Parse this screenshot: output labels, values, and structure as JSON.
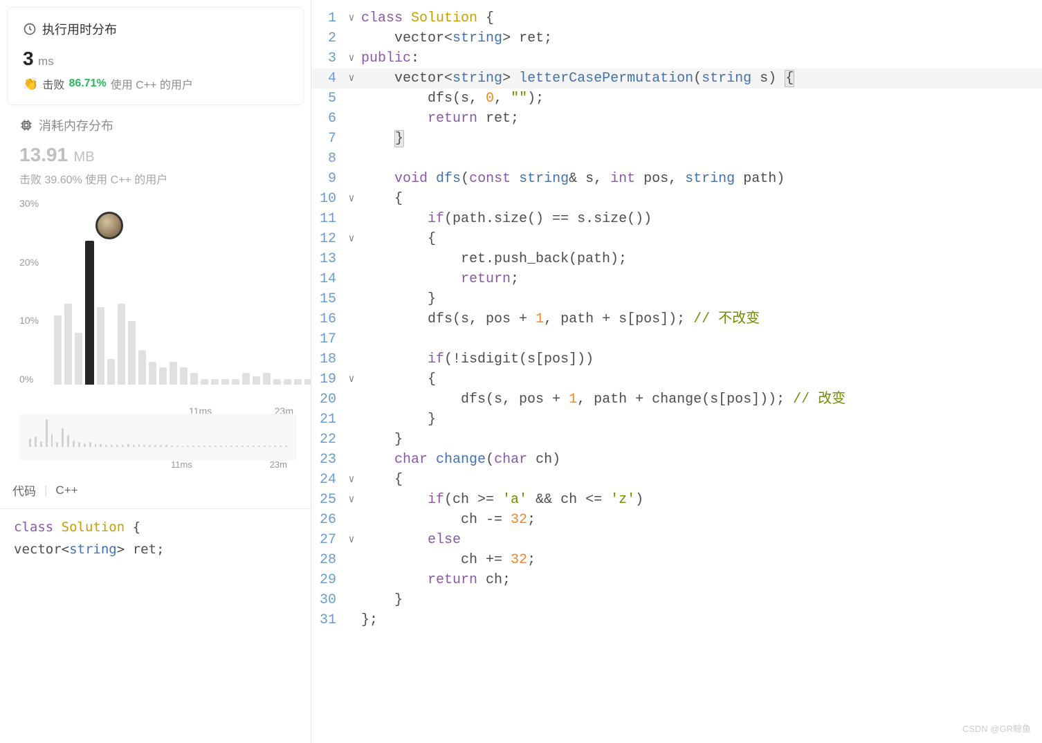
{
  "runtime": {
    "title": "执行用时分布",
    "value": "3",
    "unit": "ms",
    "beat_label": "击败",
    "beat_pct": "86.71%",
    "beat_suffix": "使用 C++ 的用户"
  },
  "memory": {
    "title": "消耗内存分布",
    "value": "13.91",
    "unit": "MB",
    "beat_text": "击败 39.60% 使用 C++ 的用户"
  },
  "chart_data": {
    "type": "bar",
    "ylabel_pct": [
      "30%",
      "20%",
      "10%",
      "0%"
    ],
    "x_ticks": [
      "11ms",
      "23m"
    ],
    "highlight_index": 3,
    "bars_pct": [
      12,
      14,
      9,
      25,
      13.5,
      4.5,
      14,
      11,
      6,
      4,
      3,
      4,
      3,
      2,
      1,
      1,
      1,
      1,
      2,
      1.5,
      2,
      1,
      1,
      1,
      1,
      1
    ],
    "mini_bars_pct": [
      18,
      22,
      12,
      60,
      28,
      10,
      40,
      26,
      14,
      10,
      8,
      10,
      8,
      6,
      4,
      4,
      4,
      4,
      6,
      5,
      6,
      4,
      4,
      4,
      4,
      4,
      3,
      3,
      3,
      3,
      3,
      3,
      3,
      3,
      3,
      3,
      3,
      3,
      3,
      3,
      3,
      3,
      3,
      3,
      3,
      3,
      3,
      3
    ],
    "mini_x_ticks": [
      "11ms",
      "23m"
    ]
  },
  "code_tab": {
    "label1": "代码",
    "lang": "C++"
  },
  "bottom_code": {
    "l1_kw": "class",
    "l1_name": "Solution",
    "l1_brace": " {",
    "l2_indent": "    ",
    "l2_type": "vector",
    "l2_lt": "<",
    "l2_inner": "string",
    "l2_gt": ">",
    "l2_var": " ret;"
  },
  "editor": {
    "lines": [
      {
        "n": "1",
        "fold": "∨",
        "seg": [
          {
            "t": "class ",
            "c": "tk-keyword"
          },
          {
            "t": "Solution",
            "c": "tk-classname"
          },
          {
            "t": " {",
            "c": "tk-punct"
          }
        ]
      },
      {
        "n": "2",
        "fold": "",
        "seg": [
          {
            "t": "    vector",
            "c": "tk-default"
          },
          {
            "t": "<",
            "c": "tk-punct"
          },
          {
            "t": "string",
            "c": "tk-type"
          },
          {
            "t": ">",
            "c": "tk-punct"
          },
          {
            "t": " ret;",
            "c": "tk-default"
          }
        ]
      },
      {
        "n": "3",
        "fold": "∨",
        "seg": [
          {
            "t": "public",
            "c": "tk-keyword"
          },
          {
            "t": ":",
            "c": "tk-punct"
          }
        ]
      },
      {
        "n": "4",
        "fold": "∨",
        "current": true,
        "seg": [
          {
            "t": "    vector",
            "c": "tk-default"
          },
          {
            "t": "<",
            "c": "tk-punct"
          },
          {
            "t": "string",
            "c": "tk-type"
          },
          {
            "t": ">",
            "c": "tk-punct"
          },
          {
            "t": " ",
            "c": "tk-default"
          },
          {
            "t": "letterCasePermutation",
            "c": "tk-name"
          },
          {
            "t": "(",
            "c": "tk-punct"
          },
          {
            "t": "string",
            "c": "tk-type"
          },
          {
            "t": " s) ",
            "c": "tk-default"
          },
          {
            "t": "{",
            "c": "tk-punct bracket-hl"
          }
        ]
      },
      {
        "n": "5",
        "fold": "",
        "seg": [
          {
            "t": "        dfs(s, ",
            "c": "tk-default"
          },
          {
            "t": "0",
            "c": "tk-number"
          },
          {
            "t": ", ",
            "c": "tk-default"
          },
          {
            "t": "\"\"",
            "c": "tk-string"
          },
          {
            "t": ");",
            "c": "tk-default"
          }
        ]
      },
      {
        "n": "6",
        "fold": "",
        "seg": [
          {
            "t": "        ",
            "c": "tk-default"
          },
          {
            "t": "return",
            "c": "tk-keyword"
          },
          {
            "t": " ret;",
            "c": "tk-default"
          }
        ]
      },
      {
        "n": "7",
        "fold": "",
        "seg": [
          {
            "t": "    ",
            "c": "tk-default"
          },
          {
            "t": "}",
            "c": "tk-punct bracket-hl"
          }
        ]
      },
      {
        "n": "8",
        "fold": "",
        "seg": []
      },
      {
        "n": "9",
        "fold": "",
        "seg": [
          {
            "t": "    ",
            "c": "tk-default"
          },
          {
            "t": "void",
            "c": "tk-keyword"
          },
          {
            "t": " ",
            "c": "tk-default"
          },
          {
            "t": "dfs",
            "c": "tk-name"
          },
          {
            "t": "(",
            "c": "tk-punct"
          },
          {
            "t": "const",
            "c": "tk-keyword"
          },
          {
            "t": " ",
            "c": "tk-default"
          },
          {
            "t": "string",
            "c": "tk-type"
          },
          {
            "t": "& s, ",
            "c": "tk-default"
          },
          {
            "t": "int",
            "c": "tk-keyword"
          },
          {
            "t": " pos, ",
            "c": "tk-default"
          },
          {
            "t": "string",
            "c": "tk-type"
          },
          {
            "t": " path)",
            "c": "tk-default"
          }
        ]
      },
      {
        "n": "10",
        "fold": "∨",
        "seg": [
          {
            "t": "    {",
            "c": "tk-punct"
          }
        ]
      },
      {
        "n": "11",
        "fold": "",
        "seg": [
          {
            "t": "        ",
            "c": "tk-default"
          },
          {
            "t": "if",
            "c": "tk-keyword"
          },
          {
            "t": "(path.size() == s.size())",
            "c": "tk-default"
          }
        ]
      },
      {
        "n": "12",
        "fold": "∨",
        "seg": [
          {
            "t": "        {",
            "c": "tk-punct"
          }
        ]
      },
      {
        "n": "13",
        "fold": "",
        "seg": [
          {
            "t": "            ret.push_back(path);",
            "c": "tk-default"
          }
        ]
      },
      {
        "n": "14",
        "fold": "",
        "seg": [
          {
            "t": "            ",
            "c": "tk-default"
          },
          {
            "t": "return",
            "c": "tk-keyword"
          },
          {
            "t": ";",
            "c": "tk-punct"
          }
        ]
      },
      {
        "n": "15",
        "fold": "",
        "seg": [
          {
            "t": "        }",
            "c": "tk-punct"
          }
        ]
      },
      {
        "n": "16",
        "fold": "",
        "seg": [
          {
            "t": "        dfs(s, pos + ",
            "c": "tk-default"
          },
          {
            "t": "1",
            "c": "tk-number"
          },
          {
            "t": ", path + s[pos]); ",
            "c": "tk-default"
          },
          {
            "t": "// 不改变",
            "c": "tk-comment"
          }
        ]
      },
      {
        "n": "17",
        "fold": "",
        "seg": []
      },
      {
        "n": "18",
        "fold": "",
        "seg": [
          {
            "t": "        ",
            "c": "tk-default"
          },
          {
            "t": "if",
            "c": "tk-keyword"
          },
          {
            "t": "(!isdigit(s[pos]))",
            "c": "tk-default"
          }
        ]
      },
      {
        "n": "19",
        "fold": "∨",
        "seg": [
          {
            "t": "        {",
            "c": "tk-punct"
          }
        ]
      },
      {
        "n": "20",
        "fold": "",
        "seg": [
          {
            "t": "            dfs(s, pos + ",
            "c": "tk-default"
          },
          {
            "t": "1",
            "c": "tk-number"
          },
          {
            "t": ", path + change(s[pos])); ",
            "c": "tk-default"
          },
          {
            "t": "// 改变",
            "c": "tk-comment"
          }
        ]
      },
      {
        "n": "21",
        "fold": "",
        "seg": [
          {
            "t": "        }",
            "c": "tk-punct"
          }
        ]
      },
      {
        "n": "22",
        "fold": "",
        "seg": [
          {
            "t": "    }",
            "c": "tk-punct"
          }
        ]
      },
      {
        "n": "23",
        "fold": "",
        "seg": [
          {
            "t": "    ",
            "c": "tk-default"
          },
          {
            "t": "char",
            "c": "tk-keyword"
          },
          {
            "t": " ",
            "c": "tk-default"
          },
          {
            "t": "change",
            "c": "tk-name"
          },
          {
            "t": "(",
            "c": "tk-punct"
          },
          {
            "t": "char",
            "c": "tk-keyword"
          },
          {
            "t": " ch)",
            "c": "tk-default"
          }
        ]
      },
      {
        "n": "24",
        "fold": "∨",
        "seg": [
          {
            "t": "    {",
            "c": "tk-punct"
          }
        ]
      },
      {
        "n": "25",
        "fold": "∨",
        "seg": [
          {
            "t": "        ",
            "c": "tk-default"
          },
          {
            "t": "if",
            "c": "tk-keyword"
          },
          {
            "t": "(ch >= ",
            "c": "tk-default"
          },
          {
            "t": "'a'",
            "c": "tk-string"
          },
          {
            "t": " && ch <= ",
            "c": "tk-default"
          },
          {
            "t": "'z'",
            "c": "tk-string"
          },
          {
            "t": ")",
            "c": "tk-default"
          }
        ]
      },
      {
        "n": "26",
        "fold": "",
        "seg": [
          {
            "t": "            ch -= ",
            "c": "tk-default"
          },
          {
            "t": "32",
            "c": "tk-number"
          },
          {
            "t": ";",
            "c": "tk-punct"
          }
        ]
      },
      {
        "n": "27",
        "fold": "∨",
        "seg": [
          {
            "t": "        ",
            "c": "tk-default"
          },
          {
            "t": "else",
            "c": "tk-keyword"
          }
        ]
      },
      {
        "n": "28",
        "fold": "",
        "seg": [
          {
            "t": "            ch += ",
            "c": "tk-default"
          },
          {
            "t": "32",
            "c": "tk-number"
          },
          {
            "t": ";",
            "c": "tk-punct"
          }
        ]
      },
      {
        "n": "29",
        "fold": "",
        "seg": [
          {
            "t": "        ",
            "c": "tk-default"
          },
          {
            "t": "return",
            "c": "tk-keyword"
          },
          {
            "t": " ch;",
            "c": "tk-default"
          }
        ]
      },
      {
        "n": "30",
        "fold": "",
        "seg": [
          {
            "t": "    }",
            "c": "tk-punct"
          }
        ]
      },
      {
        "n": "31",
        "fold": "",
        "seg": [
          {
            "t": "};",
            "c": "tk-punct"
          }
        ]
      }
    ]
  },
  "watermark": "CSDN @GR鲸鱼"
}
